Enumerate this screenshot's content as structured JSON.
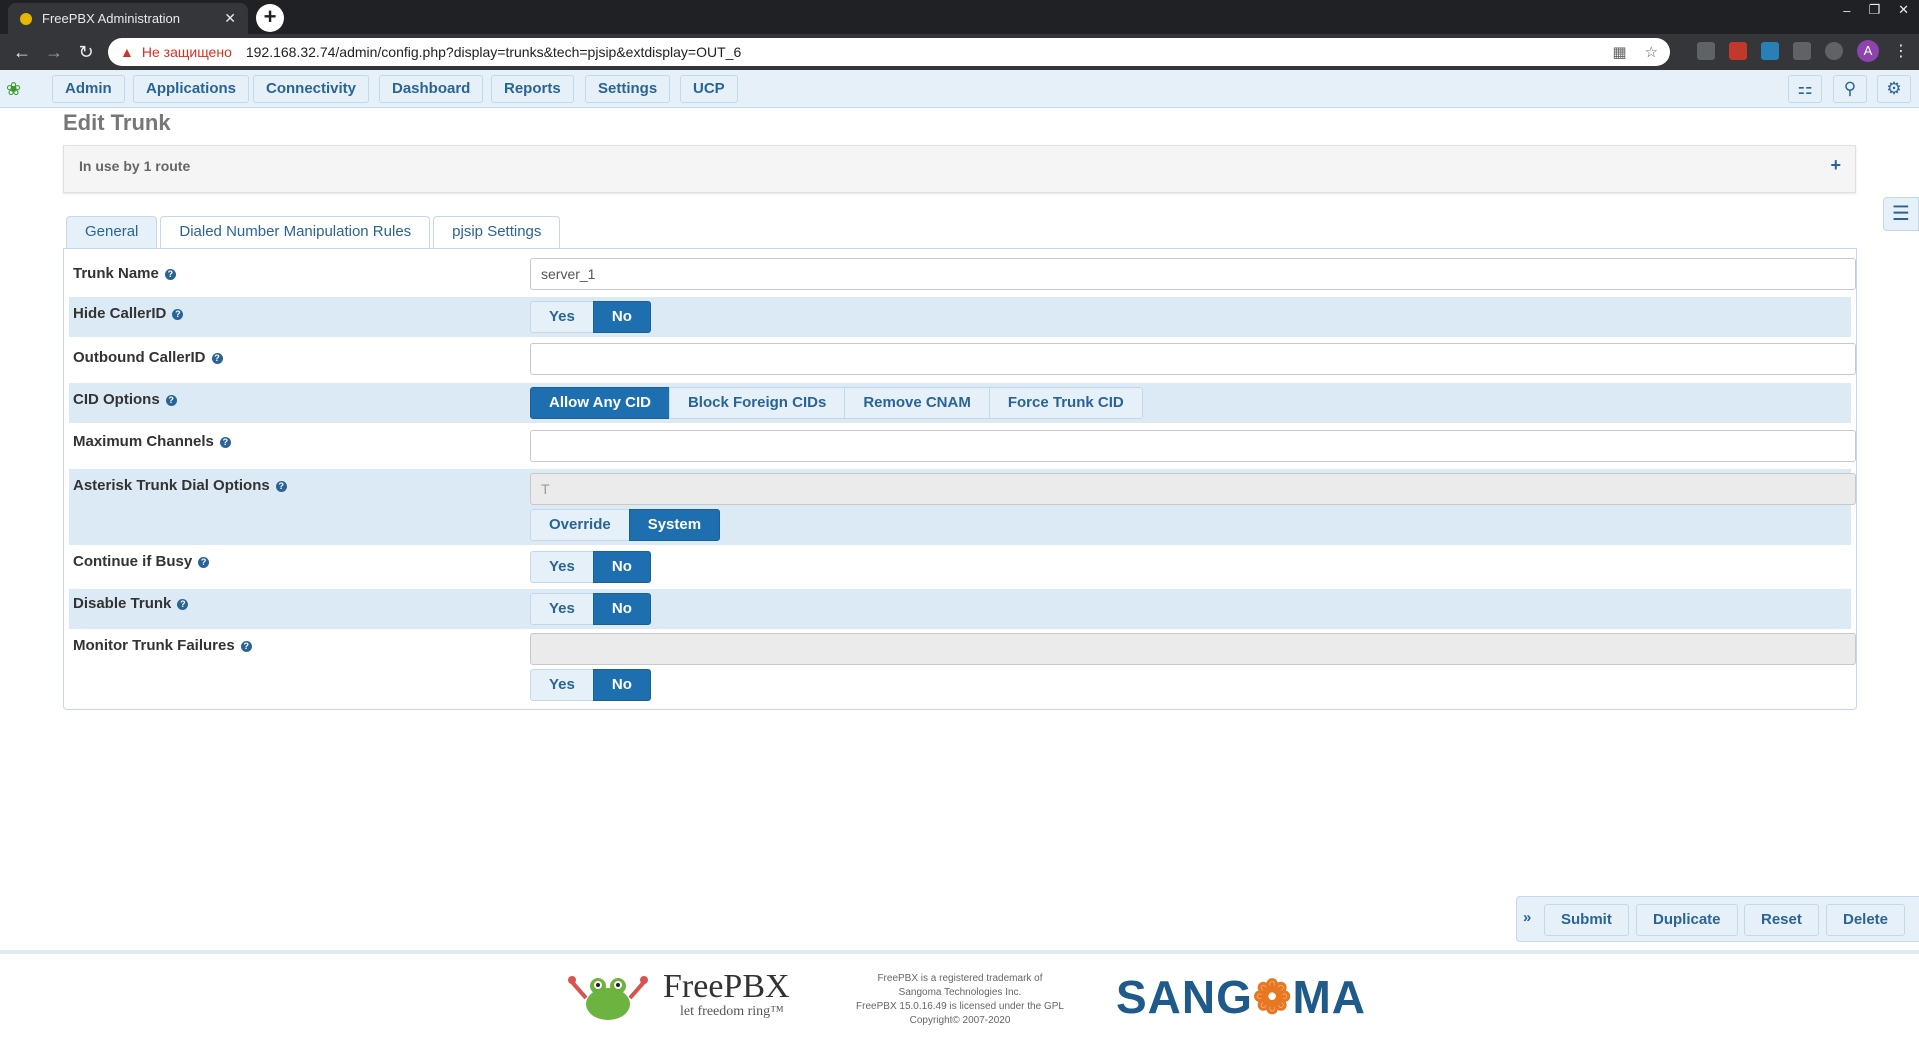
{
  "browser": {
    "tab_title": "FreePBX Administration",
    "tab_close": "✕",
    "new_tab": "+",
    "insecure_label": "Не защищено",
    "url": "192.168.32.74/admin/config.php?display=trunks&tech=pjsip&extdisplay=OUT_6",
    "profile_initial": "A",
    "window_min": "–",
    "window_restore": "❐",
    "window_close": "✕"
  },
  "nav": {
    "items": [
      "Admin",
      "Applications",
      "Connectivity",
      "Dashboard",
      "Reports",
      "Settings",
      "UCP"
    ]
  },
  "page": {
    "title": "Edit Trunk",
    "in_use": "In use by 1 route",
    "expand": "+"
  },
  "tabs": [
    "General",
    "Dialed Number Manipulation Rules",
    "pjsip Settings"
  ],
  "form": {
    "trunk_name": {
      "label": "Trunk Name",
      "value": "server_1"
    },
    "hide_callerid": {
      "label": "Hide CallerID",
      "options": [
        "Yes",
        "No"
      ],
      "selected": "No"
    },
    "outbound_callerid": {
      "label": "Outbound CallerID",
      "value": ""
    },
    "cid_options": {
      "label": "CID Options",
      "options": [
        "Allow Any CID",
        "Block Foreign CIDs",
        "Remove CNAM",
        "Force Trunk CID"
      ],
      "selected": "Allow Any CID"
    },
    "max_channels": {
      "label": "Maximum Channels",
      "value": ""
    },
    "dial_options": {
      "label": "Asterisk Trunk Dial Options",
      "value": "T",
      "options": [
        "Override",
        "System"
      ],
      "selected": "System"
    },
    "continue_busy": {
      "label": "Continue if Busy",
      "options": [
        "Yes",
        "No"
      ],
      "selected": "No"
    },
    "disable_trunk": {
      "label": "Disable Trunk",
      "options": [
        "Yes",
        "No"
      ],
      "selected": "No"
    },
    "monitor_failures": {
      "label": "Monitor Trunk Failures",
      "value": "",
      "options": [
        "Yes",
        "No"
      ],
      "selected": "No"
    }
  },
  "actions": {
    "toggle": "»",
    "submit": "Submit",
    "duplicate": "Duplicate",
    "reset": "Reset",
    "delete": "Delete"
  },
  "footer": {
    "freepbx_name": "FreePBX",
    "freepbx_tag": "let freedom ring™",
    "legal_lines": [
      "FreePBX is a registered trademark of",
      "Sangoma Technologies Inc.",
      "FreePBX 15.0.16.49 is licensed under the GPL",
      "Copyright© 2007-2020"
    ],
    "sangoma_before": "SANG",
    "sangoma_o": "❁",
    "sangoma_after": "MA"
  },
  "icons": {
    "help": "question-icon",
    "language": "language-icon",
    "search": "search-icon",
    "settings": "gear-icon",
    "sidebar": "list-icon"
  },
  "colors": {
    "accent": "#1e6fb0",
    "nav_bg": "#e6f0f8",
    "stripe": "#dceaf6",
    "link": "#2a6496"
  }
}
